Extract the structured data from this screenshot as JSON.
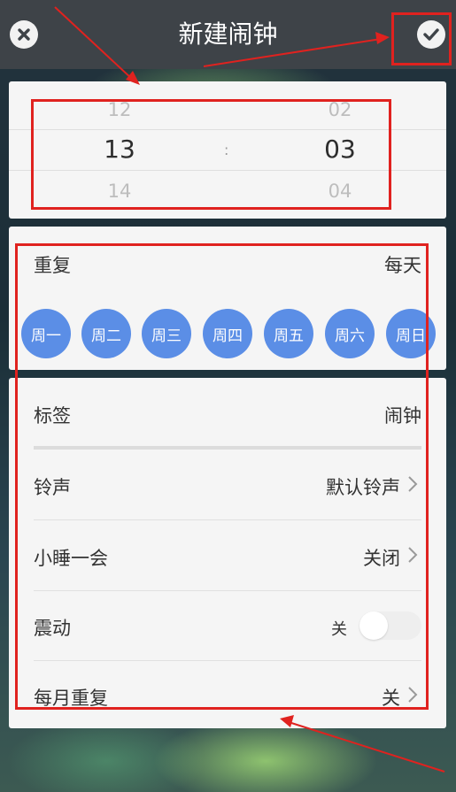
{
  "header": {
    "title": "新建闹钟",
    "close_icon": "close-circle-icon",
    "confirm_icon": "check-circle-icon"
  },
  "picker": {
    "hour_prev": "12",
    "hour": "13",
    "hour_next": "14",
    "separator": ":",
    "minute_prev": "02",
    "minute": "03",
    "minute_next": "04"
  },
  "repeat": {
    "label": "重复",
    "value": "每天",
    "days": [
      "周一",
      "周二",
      "周三",
      "周四",
      "周五",
      "周六",
      "周日"
    ]
  },
  "settings": {
    "tag_label": "标签",
    "tag_value": "闹钟",
    "ringtone_label": "铃声",
    "ringtone_value": "默认铃声",
    "snooze_label": "小睡一会",
    "snooze_value": "关闭",
    "vibrate_label": "震动",
    "vibrate_value": "关",
    "monthly_label": "每月重复",
    "monthly_value": "关"
  },
  "colors": {
    "header": "#3e4348",
    "day_chip": "#5b8ee6",
    "annotation": "#e0221f"
  }
}
